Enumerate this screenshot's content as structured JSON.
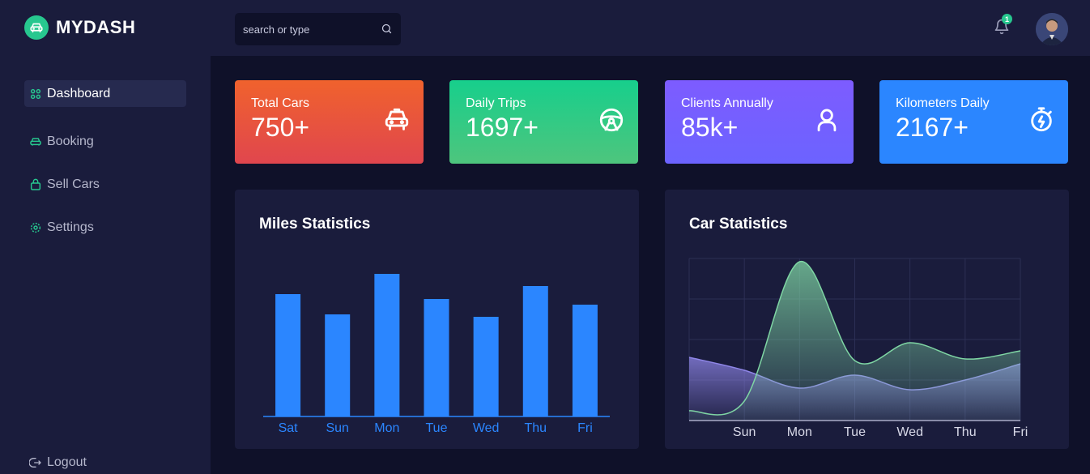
{
  "brand": {
    "name": "MYDASH",
    "accent": "#27c78f"
  },
  "search": {
    "placeholder": "search or type"
  },
  "notifications": {
    "count": "1"
  },
  "sidebar": {
    "items": [
      {
        "label": "Dashboard",
        "icon": "grid-icon",
        "active": true
      },
      {
        "label": "Booking",
        "icon": "car-icon"
      },
      {
        "label": "Sell Cars",
        "icon": "bag-icon"
      },
      {
        "label": "Settings",
        "icon": "gear-icon"
      }
    ],
    "logout": "Logout"
  },
  "cards": [
    {
      "label": "Total Cars",
      "value": "750+",
      "icon": "car-front-icon",
      "colors": [
        "#f0622d",
        "#e0464e"
      ]
    },
    {
      "label": "Daily Trips",
      "value": "1697+",
      "icon": "steering-wheel-icon",
      "colors": [
        "#17cf8c",
        "#4ec57d"
      ]
    },
    {
      "label": "Clients Annually",
      "value": "85k+",
      "icon": "user-icon",
      "colors": [
        "#7d5cff",
        "#6c63ff"
      ]
    },
    {
      "label": "Kilometers Daily",
      "value": "2167+",
      "icon": "stopwatch-icon",
      "colors": [
        "#2b86ff",
        "#2b86ff"
      ]
    }
  ],
  "chart_data": [
    {
      "type": "bar",
      "title": "Miles Statistics",
      "categories": [
        "Sat",
        "Sun",
        "Mon",
        "Tue",
        "Wed",
        "Thu",
        "Fri"
      ],
      "values": [
        151,
        126,
        176,
        145,
        123,
        161,
        138
      ],
      "ylim": [
        0,
        190
      ],
      "color": "#2b86ff",
      "grid": false
    },
    {
      "type": "area",
      "title": "Car Statistics",
      "categories": [
        "Sun",
        "Mon",
        "Tue",
        "Wed",
        "Thu",
        "Fri"
      ],
      "series": [
        {
          "values": [
            12,
            98,
            37,
            48,
            38,
            43
          ],
          "color": "#7fd6a4"
        },
        {
          "values": [
            31,
            20,
            28,
            19,
            25,
            35
          ],
          "color": "#8f86e8"
        }
      ],
      "ylim": [
        0,
        100
      ],
      "grid": true
    }
  ]
}
